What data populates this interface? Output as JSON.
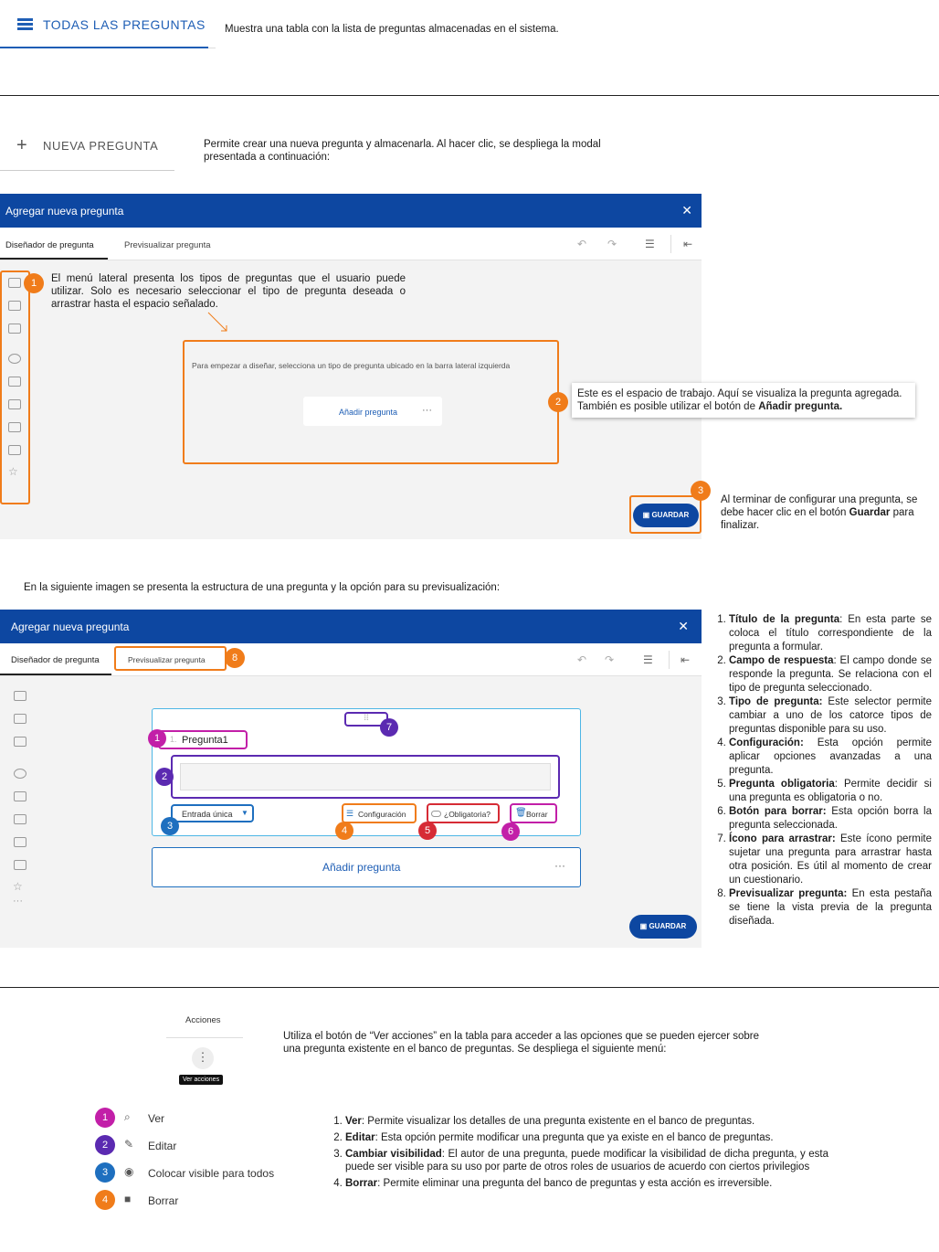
{
  "top_tab": {
    "label": "TODAS LAS PREGUNTAS",
    "desc": "Muestra una tabla con la lista de preguntas almacenadas en el sistema."
  },
  "new_question": {
    "label": "NUEVA PREGUNTA",
    "desc": "Permite crear una nueva pregunta y almacenarla. Al hacer clic, se despliega la modal presentada a continuación:"
  },
  "modal1": {
    "title": "Agregar nueva pregunta",
    "close": "✕",
    "tab_designer": "Diseñador de pregunta",
    "tab_preview": "Previsualizar pregunta",
    "callout1_num": "1",
    "callout1_text": "El menú lateral presenta los tipos de preguntas que el usuario puede utilizar. Solo es necesario seleccionar el tipo de pregunta deseada o arrastrar hasta el espacio señalado.",
    "workarea_text": "Para empezar a diseñar, selecciona un tipo de pregunta ubicado en la barra lateral izquierda",
    "add_question": "Añadir pregunta",
    "dots": "···",
    "callout2_num": "2",
    "callout2_text_a": "Este es el espacio de trabajo. Aquí se visualiza la pregunta agregada. También es posible utilizar el botón de ",
    "callout2_text_b": "Añadir pregunta.",
    "callout3_num": "3",
    "save": "GUARDAR",
    "callout3_text_a": "Al terminar de configurar una pregunta, se debe hacer clic en el botón ",
    "callout3_text_b": "Guardar",
    "callout3_text_c": " para finalizar."
  },
  "intro2": "En la siguiente imagen se presenta la estructura de una pregunta y la opción para su previsualización:",
  "modal2": {
    "title": "Agregar nueva pregunta",
    "close": "✕",
    "tab_designer": "Diseñador de pregunta",
    "tab_preview": "Previsualizar pregunta",
    "question_title": "Pregunta1",
    "question_prefix": "1.",
    "type_select": "Entrada única",
    "config": "Configuración",
    "required": "¿Obligatoria?",
    "delete": "Borrar",
    "add_question": "Añadir pregunta",
    "dots": "···",
    "save": "GUARDAR",
    "badges": [
      "1",
      "2",
      "3",
      "4",
      "5",
      "6",
      "7",
      "8"
    ]
  },
  "structure_list": [
    {
      "term": "Título de la pregunta",
      "sep": ": ",
      "text": "En esta parte se coloca el título correspondiente de la pregunta a formular."
    },
    {
      "term": "Campo de respuesta",
      "sep": ": ",
      "text": "El campo donde se responde la pregunta. Se relaciona con el tipo de pregunta seleccionado."
    },
    {
      "term": "Tipo de pregunta:",
      "sep": " ",
      "text": "Este selector permite cambiar a uno de los catorce tipos de preguntas disponible para su uso."
    },
    {
      "term": "Configuración:",
      "sep": " ",
      "text": "Esta opción permite aplicar opciones avanzadas a una pregunta."
    },
    {
      "term": "Pregunta obligatoria",
      "sep": ": ",
      "text": "Permite decidir si una pregunta es obligatoria o no."
    },
    {
      "term": "Botón para borrar:",
      "sep": " ",
      "text": "Esta opción borra la pregunta seleccionada."
    },
    {
      "term": "Ícono para arrastrar:",
      "sep": " ",
      "text": "Este ícono permite sujetar una pregunta para arrastrar hasta otra posición. Es útil al momento de crear un cuestionario."
    },
    {
      "term": "Previsualizar pregunta:",
      "sep": " ",
      "text": "En esta pestaña se tiene la vista previa de la pregunta diseñada."
    }
  ],
  "actions": {
    "header": "Acciones",
    "tooltip": "Ver acciones",
    "desc": "Utiliza el botón de “Ver acciones” en la tabla para acceder a las opciones que se pueden ejercer sobre una pregunta existente en el banco de preguntas. Se despliega el siguiente menú:",
    "menu": [
      {
        "num": "1",
        "icon": "search-icon",
        "label": "Ver",
        "color": "#c21fa8"
      },
      {
        "num": "2",
        "icon": "pencil-icon",
        "label": "Editar",
        "color": "#5b2ab1"
      },
      {
        "num": "3",
        "icon": "eye-icon",
        "label": "Colocar visible para todos",
        "color": "#1e6fbf"
      },
      {
        "num": "4",
        "icon": "trash-icon",
        "label": "Borrar",
        "color": "#f07c1a"
      }
    ],
    "list": [
      {
        "term": "Ver",
        "text": ": Permite visualizar los detalles de una pregunta existente en el banco de preguntas."
      },
      {
        "term": "Editar",
        "text": ": Esta opción permite modificar una pregunta que ya existe en el banco de preguntas."
      },
      {
        "term": "Cambiar visibilidad",
        "text": ": El autor de una pregunta, puede modificar la visibilidad de dicha pregunta, y esta puede ser visible para su uso por parte de otros roles de usuarios de acuerdo con ciertos privilegios"
      },
      {
        "term": "Borrar",
        "text": ": Permite eliminar una pregunta del banco de preguntas y esta acción es irreversible."
      }
    ]
  }
}
